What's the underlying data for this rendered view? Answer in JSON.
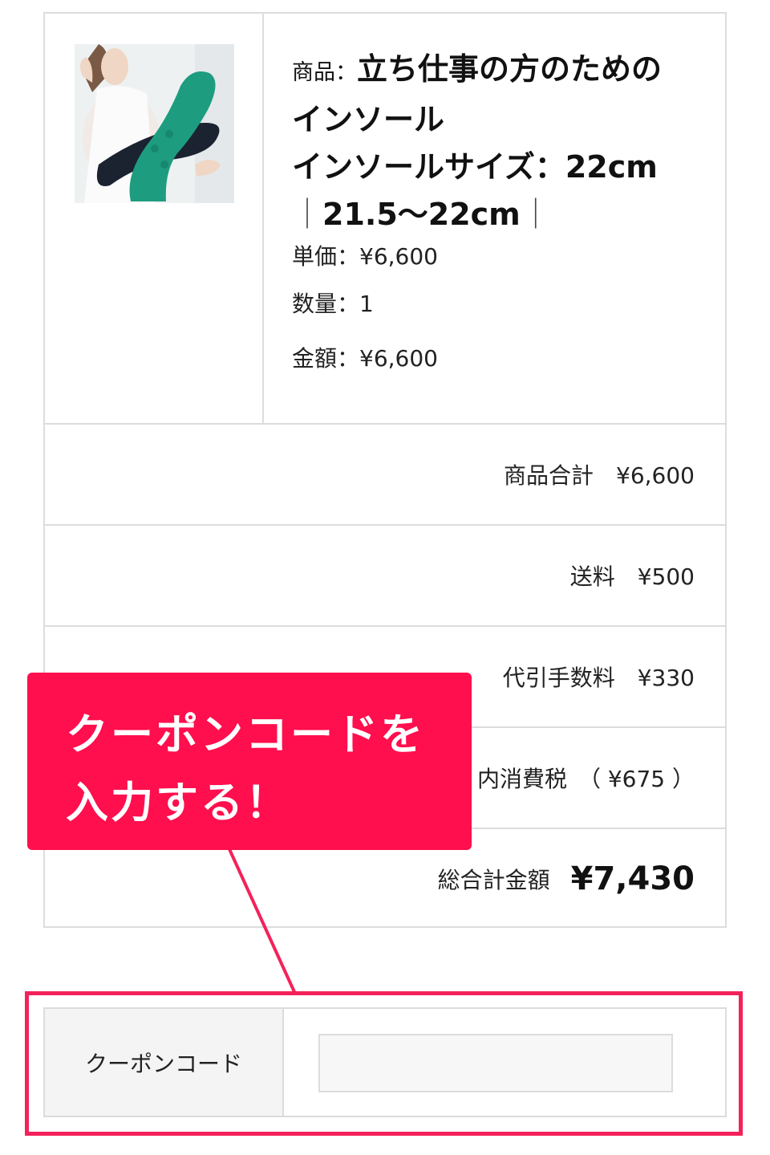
{
  "product": {
    "name_label": "商品：",
    "name_line1": "立ち仕事の方のための",
    "name_line2": "インソール",
    "size_line": "インソールサイズ：22cm",
    "size_range": "21.5〜22cm",
    "unit_price_label": "単価：",
    "unit_price": "¥6,600",
    "quantity_label": "数量：",
    "quantity": "1",
    "amount_label": "金額：",
    "amount": "¥6,600"
  },
  "summary": {
    "subtotal": "商品合計　¥6,600",
    "shipping": "送料　¥500",
    "cod_fee": "代引手数料　¥330",
    "tax": "内消費税　（ ¥675 ）",
    "total_label": "総合計金額",
    "total": "¥7,430"
  },
  "callout": {
    "text": "クーポンコードを\n入力する！",
    "color": "#ff0f4d"
  },
  "coupon": {
    "label": "クーポンコード",
    "value": "",
    "highlight_color": "#f3225a"
  }
}
